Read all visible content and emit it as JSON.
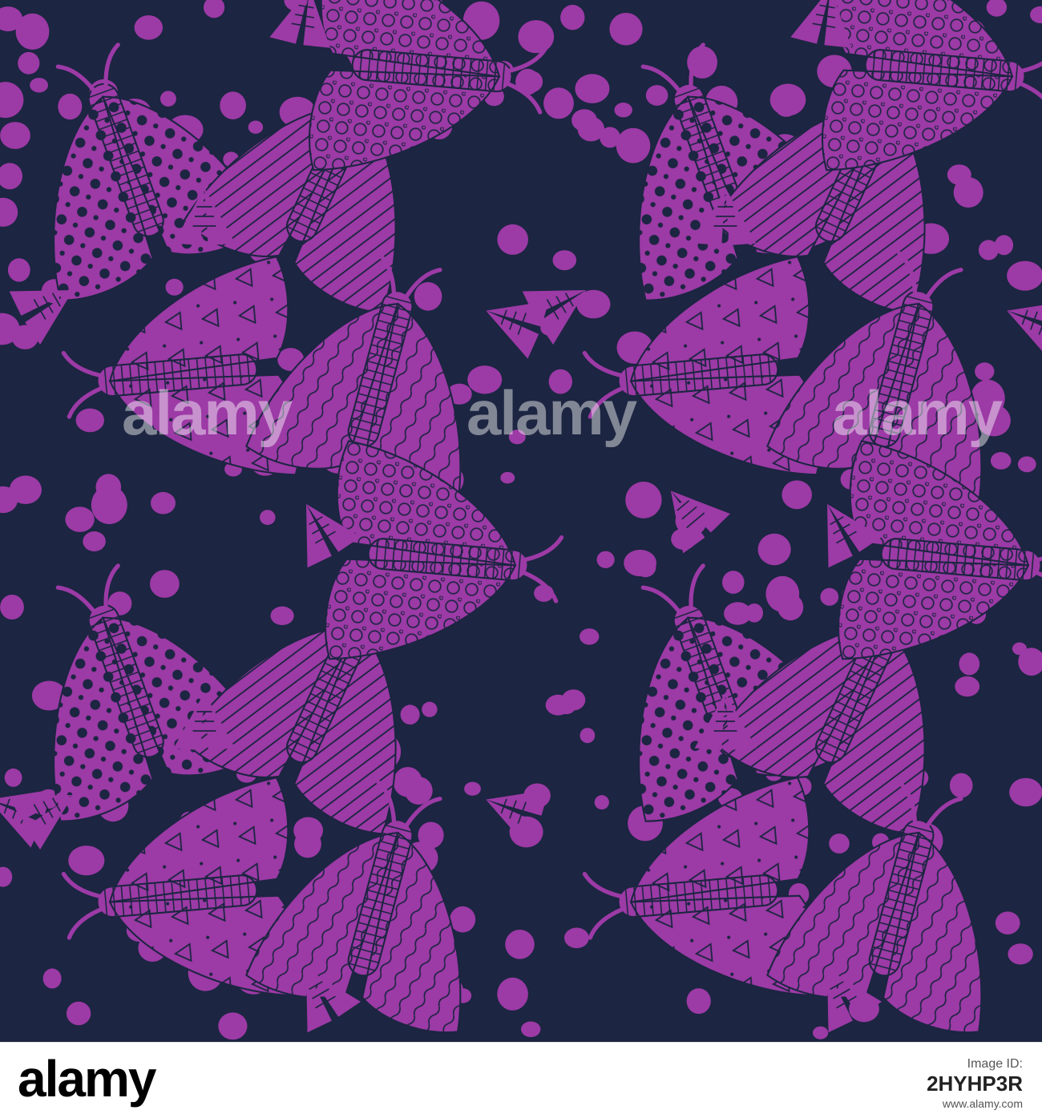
{
  "watermark": {
    "text": "alamy"
  },
  "footer": {
    "logo_text": "alamy",
    "image_id_label": "Image ID:",
    "image_id": "2HYHP3R",
    "site": "www.alamy.com"
  },
  "colors": {
    "background": "#1c2541",
    "motif": "#9c3aa6",
    "outline": "#1c2541"
  },
  "icons": [
    "moth-motif",
    "dot-motif",
    "alamy-logo"
  ]
}
